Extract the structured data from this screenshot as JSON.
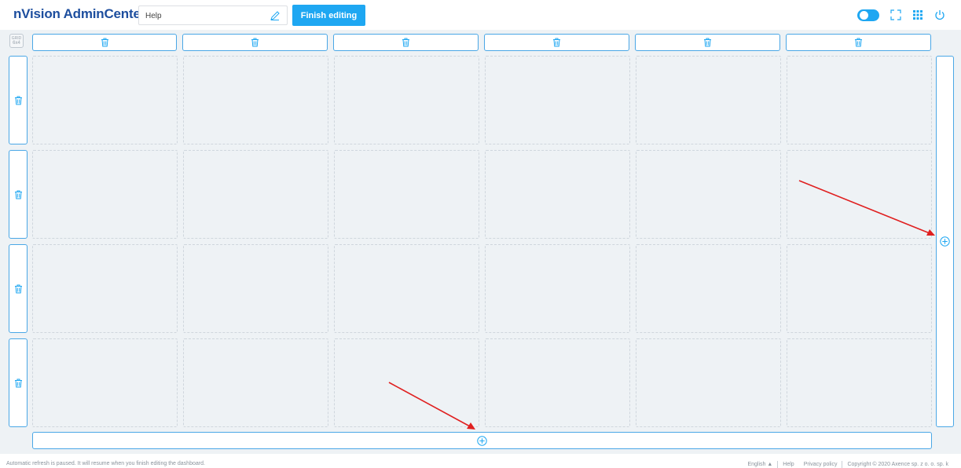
{
  "header": {
    "logo": "nVision AdminCenter",
    "dashboard_name_value": "Help",
    "finish_label": "Finish editing",
    "icons": [
      "theme-toggle-icon",
      "fullscreen-icon",
      "apps-grid-icon",
      "power-icon"
    ]
  },
  "grid": {
    "badge_top": "GRID",
    "badge_bottom": "6x4",
    "columns": 6,
    "rows": 4
  },
  "footer": {
    "status": "Automatic refresh is paused. It will resume when you finish editing the dashboard.",
    "language": "English ▲",
    "help": "Help",
    "privacy": "Privacy policy",
    "copyright": "Copyright © 2020 Axence sp. z o. o. sp. k"
  },
  "colors": {
    "accent": "#1ea7f2",
    "brand": "#1d4e9e",
    "annotation_arrow": "#e02020",
    "canvas": "#eef2f5"
  }
}
